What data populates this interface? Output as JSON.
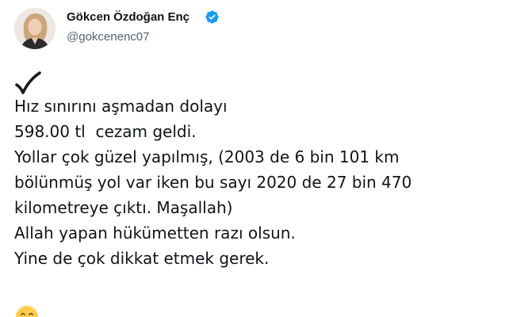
{
  "author": {
    "display_name": "Gökcen Özdoğan Enç",
    "handle": "@gokcenenc07",
    "verified": true,
    "avatar_icon": "profile-photo",
    "verified_color": "#1d9bf0"
  },
  "tweet": {
    "leading_icon": "check-mark-icon",
    "lines": [
      "Hız sınırını aşmadan dolayı",
      "598.00 tl  cezam geldi.",
      "Yollar çok güzel yapılmış, (2003 de 6 bin 101 km",
      "bölünmüş yol var iken bu sayı 2020 de 27 bin 470",
      "kilometreye çıktı. Maşallah)",
      "Allah yapan hükümetten razı olsun.",
      "Yine de çok dikkat etmek gerek."
    ],
    "trailing_icon": "emoji-icon"
  },
  "colors": {
    "text": "#0f1419",
    "secondary_text": "#536471",
    "background": "#ffffff"
  }
}
